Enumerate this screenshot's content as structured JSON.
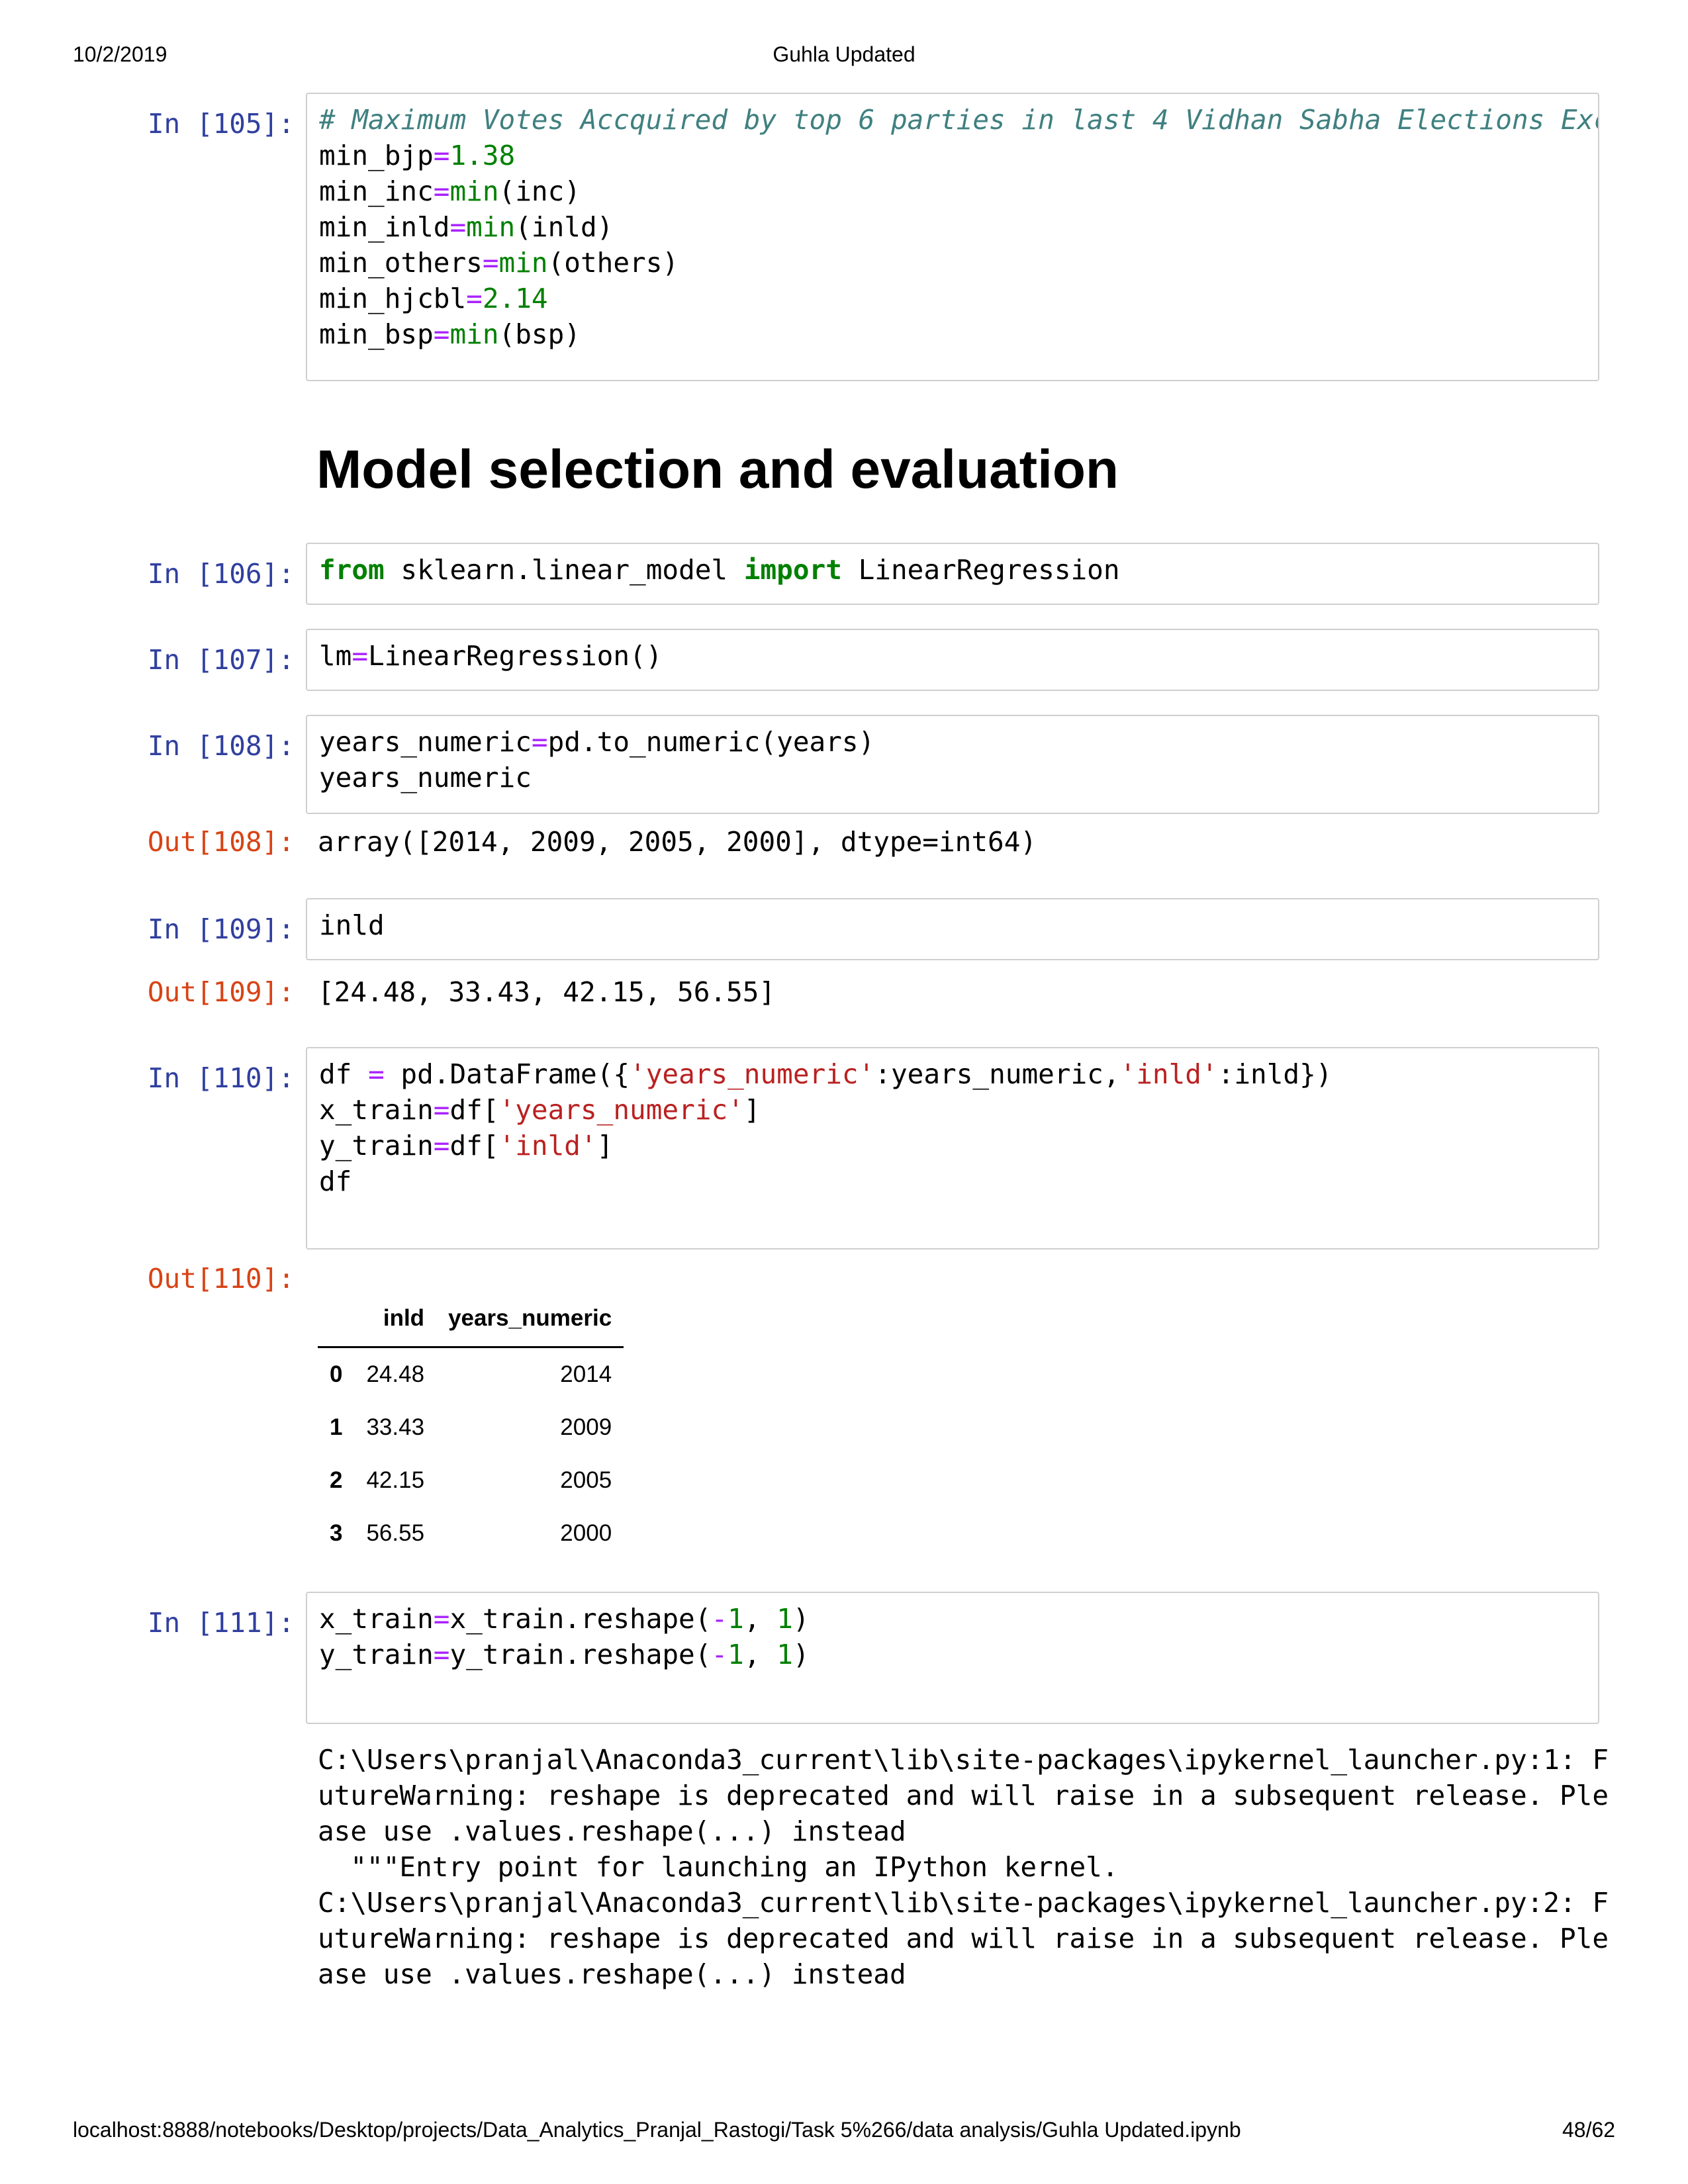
{
  "header": {
    "date": "10/2/2019",
    "title": "Guhla Updated"
  },
  "footer": {
    "url": "localhost:8888/notebooks/Desktop/projects/Data_Analytics_Pranjal_Rastogi/Task 5%266/data analysis/Guhla Updated.ipynb",
    "page": "48/62"
  },
  "cells": {
    "c105": {
      "prompt": "In [105]:",
      "comment": "# Maximum Votes Accquired by top 6 parties in last 4 Vidhan Sabha Elections Excep"
    },
    "c106": {
      "prompt": "In [106]:"
    },
    "c107": {
      "prompt": "In [107]:"
    },
    "c108": {
      "prompt": "In [108]:",
      "out_prompt": "Out[108]:",
      "output": "array([2014, 2009, 2005, 2000], dtype=int64)"
    },
    "c109": {
      "prompt": "In [109]:",
      "out_prompt": "Out[109]:",
      "output": "[24.48, 33.43, 42.15, 56.55]"
    },
    "c110": {
      "prompt": "In [110]:",
      "out_prompt": "Out[110]:"
    },
    "c111": {
      "prompt": "In [111]:"
    }
  },
  "heading": "Model selection and evaluation",
  "dataframe": {
    "columns": [
      "inld",
      "years_numeric"
    ],
    "rows": [
      {
        "index": "0",
        "inld": "24.48",
        "years_numeric": "2014"
      },
      {
        "index": "1",
        "inld": "33.43",
        "years_numeric": "2009"
      },
      {
        "index": "2",
        "inld": "42.15",
        "years_numeric": "2005"
      },
      {
        "index": "3",
        "inld": "56.55",
        "years_numeric": "2000"
      }
    ]
  },
  "warning_lines": [
    "C:\\Users\\pranjal\\Anaconda3_current\\lib\\site-packages\\ipykernel_launcher.py:1: F",
    "utureWarning: reshape is deprecated and will raise in a subsequent release. Ple",
    "ase use .values.reshape(...) instead",
    "  \"\"\"Entry point for launching an IPython kernel.",
    "C:\\Users\\pranjal\\Anaconda3_current\\lib\\site-packages\\ipykernel_launcher.py:2: F",
    "utureWarning: reshape is deprecated and will raise in a subsequent release. Ple",
    "ase use .values.reshape(...) instead"
  ],
  "code": {
    "t105_1a": "min_bjp",
    "t105_1b": "=",
    "t105_1c": "1.38",
    "t105_2a": "min_inc",
    "t105_2b": "=",
    "t105_2c": "min",
    "t105_2d": "(inc)",
    "t105_3a": "min_inld",
    "t105_3b": "=",
    "t105_3c": "min",
    "t105_3d": "(inld)",
    "t105_4a": "min_others",
    "t105_4b": "=",
    "t105_4c": "min",
    "t105_4d": "(others)",
    "t105_5a": "min_hjcbl",
    "t105_5b": "=",
    "t105_5c": "2.14",
    "t105_6a": "min_bsp",
    "t105_6b": "=",
    "t105_6c": "min",
    "t105_6d": "(bsp)",
    "t106_a": "from",
    "t106_b": " sklearn.linear_model ",
    "t106_c": "import",
    "t106_d": " LinearRegression",
    "t107_a": "lm",
    "t107_b": "=",
    "t107_c": "LinearRegression()",
    "t108_1a": "years_numeric",
    "t108_1b": "=",
    "t108_1c": "pd.to_numeric(years)",
    "t108_2": "years_numeric",
    "t109": "inld",
    "t110_1a": "df ",
    "t110_1b": "=",
    "t110_1c": " pd.DataFrame({",
    "t110_1d": "'years_numeric'",
    "t110_1e": ":years_numeric,",
    "t110_1f": "'inld'",
    "t110_1g": ":inld})",
    "t110_2a": "x_train",
    "t110_2b": "=",
    "t110_2c": "df[",
    "t110_2d": "'years_numeric'",
    "t110_2e": "]",
    "t110_3a": "y_train",
    "t110_3b": "=",
    "t110_3c": "df[",
    "t110_3d": "'inld'",
    "t110_3e": "]",
    "t110_4": "df",
    "t111_1a": "x_train",
    "t111_1b": "=",
    "t111_1c": "x_train.reshape(",
    "t111_1d": "-",
    "t111_1e": "1",
    "t111_1f": ", ",
    "t111_1g": "1",
    "t111_1h": ")",
    "t111_2a": "y_train",
    "t111_2b": "=",
    "t111_2c": "y_train.reshape(",
    "t111_2d": "-",
    "t111_2e": "1",
    "t111_2f": ", ",
    "t111_2g": "1",
    "t111_2h": ")"
  }
}
